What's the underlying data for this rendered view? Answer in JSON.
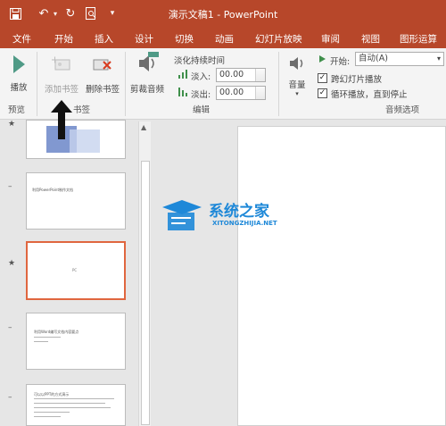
{
  "window": {
    "title": "演示文稿1 - PowerPoint"
  },
  "tabs": [
    "文件",
    "开始",
    "插入",
    "设计",
    "切换",
    "动画",
    "幻灯片放映",
    "审阅",
    "视图",
    "图形运算"
  ],
  "ribbon": {
    "preview": {
      "button": "播放",
      "group": "预览"
    },
    "bookmark": {
      "add": "添加书签",
      "remove": "删除书签",
      "group": "书签"
    },
    "edit": {
      "trim": "剪裁音频",
      "fade_title": "淡化持续时间",
      "fade_in_label": "淡入:",
      "fade_in_value": "00.00",
      "fade_out_label": "淡出:",
      "fade_out_value": "00.00",
      "group": "编辑"
    },
    "audio_options": {
      "volume": "音量",
      "start_label": "开始:",
      "start_value": "自动(A)",
      "cross_slides": "跨幻灯片播放",
      "loop": "循环播放，直到停止",
      "group": "音频选项"
    }
  },
  "thumbnails": [
    {
      "marker": "★",
      "text": ""
    },
    {
      "marker": "–",
      "text": "利用PowerPoint制作文档"
    },
    {
      "marker": "★",
      "text": "PC"
    },
    {
      "marker": "–",
      "text": "利用Word编写文档内容要点"
    },
    {
      "marker": "–",
      "text": "可以以PPT的方式演示"
    }
  ],
  "watermark": {
    "name": "系统之家",
    "url": "XITONGZHIJIA.NET"
  },
  "colors": {
    "accent": "#b7472a",
    "selection": "#e0663f"
  }
}
